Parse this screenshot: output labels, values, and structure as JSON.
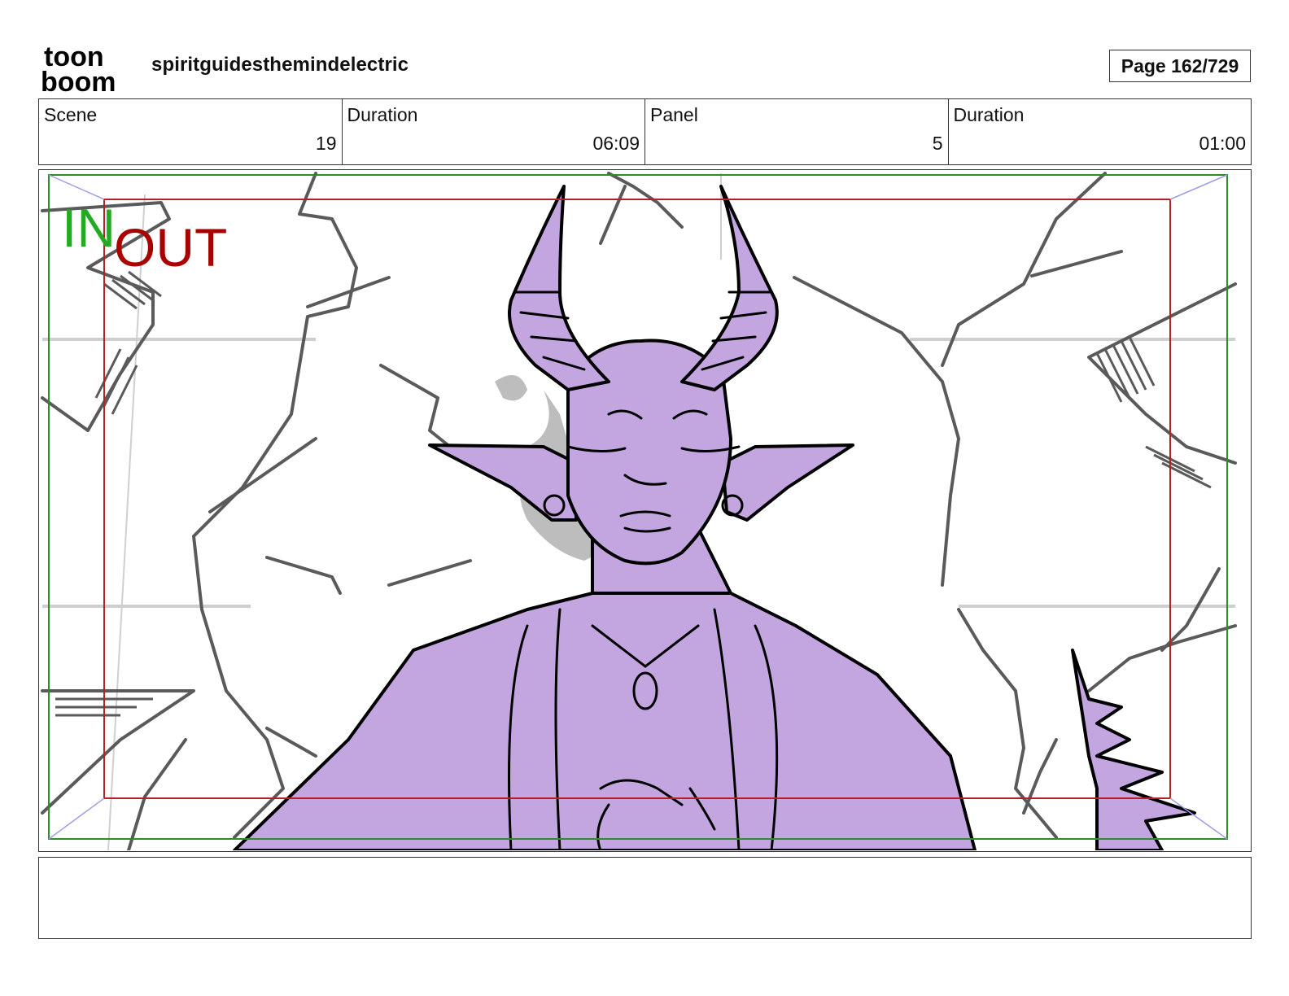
{
  "header": {
    "logo_top": "toon",
    "logo_bottom": "boom",
    "project_title": "spiritguidesthemindelectric",
    "page_label": "Page 162/729"
  },
  "info": [
    {
      "label": "Scene",
      "value": "19"
    },
    {
      "label": "Duration",
      "value": "06:09"
    },
    {
      "label": "Panel",
      "value": "5"
    },
    {
      "label": "Duration",
      "value": "01:00"
    }
  ],
  "panel": {
    "in_marker": "IN",
    "out_marker": "OUT",
    "colors": {
      "character_fill": "#c3a5e0",
      "safe_area": "#2e8b2e",
      "action_safe": "#b22222",
      "in_text": "#22aa22",
      "out_text": "#aa0000",
      "sketch_lines": "#5a5a5a"
    }
  },
  "notes": {
    "text": ""
  }
}
